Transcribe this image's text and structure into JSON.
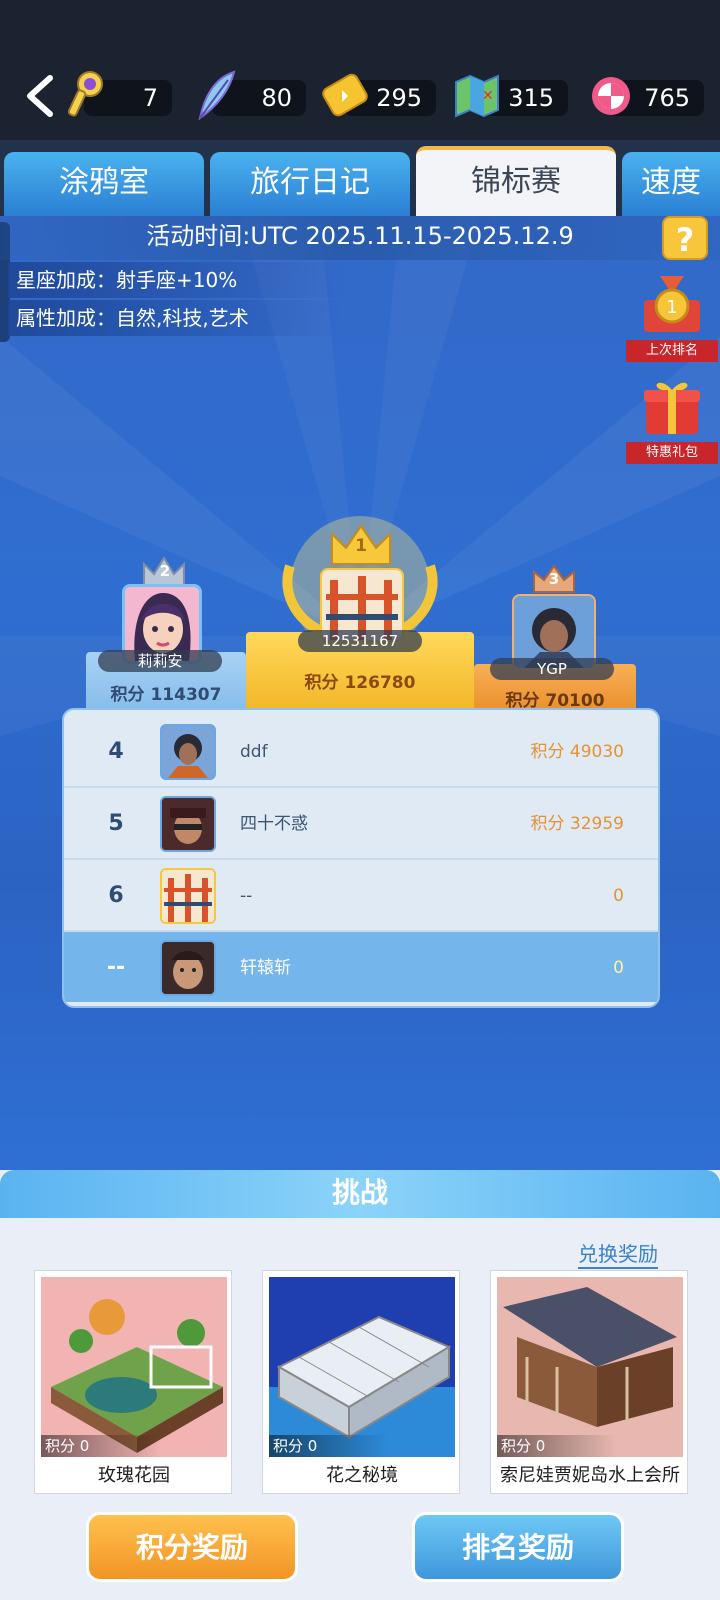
{
  "resources": [
    {
      "icon": "key-icon",
      "value": "7"
    },
    {
      "icon": "feather-icon",
      "value": "80"
    },
    {
      "icon": "ticket-icon",
      "value": "295"
    },
    {
      "icon": "map-icon",
      "value": "315"
    },
    {
      "icon": "candy-icon",
      "value": "765"
    }
  ],
  "tabs": [
    "涂鸦室",
    "旅行日记",
    "锦标赛",
    "速度"
  ],
  "event": {
    "time": "活动时间:UTC 2025.11.15-2025.12.9",
    "constellation": "星座加成：射手座+10%",
    "attributes": "属性加成：自然,科技,艺术",
    "help": "?"
  },
  "side": {
    "last_rank": "上次排名",
    "special_pack": "特惠礼包"
  },
  "podium": {
    "first": {
      "rank": "1",
      "name": "12531167",
      "score": "积分 126780"
    },
    "second": {
      "rank": "2",
      "name": "莉莉安",
      "score": "积分 114307"
    },
    "third": {
      "rank": "3",
      "name": "YGP",
      "score": "积分 70100"
    }
  },
  "ranking": [
    {
      "rank": "4",
      "name": "ddf",
      "score": "积分 49030"
    },
    {
      "rank": "5",
      "name": "四十不惑",
      "score": "积分 32959"
    },
    {
      "rank": "6",
      "name": "--",
      "score": "0"
    },
    {
      "rank": "--",
      "name": "轩辕斩",
      "score": "0"
    }
  ],
  "challenge": {
    "title": "挑战",
    "exchange": "兑换奖励",
    "cards": [
      {
        "name": "玫瑰花园",
        "score": "积分 0"
      },
      {
        "name": "花之秘境",
        "score": "积分 0"
      },
      {
        "name": "索尼娃贾妮岛水上会所",
        "score": "积分 0"
      }
    ],
    "points_reward": "积分奖励",
    "rank_reward": "排名奖励"
  },
  "colors": {
    "accent": "#f2b84a",
    "brand_blue": "#2f6ed0",
    "score_orange": "#e49232"
  }
}
